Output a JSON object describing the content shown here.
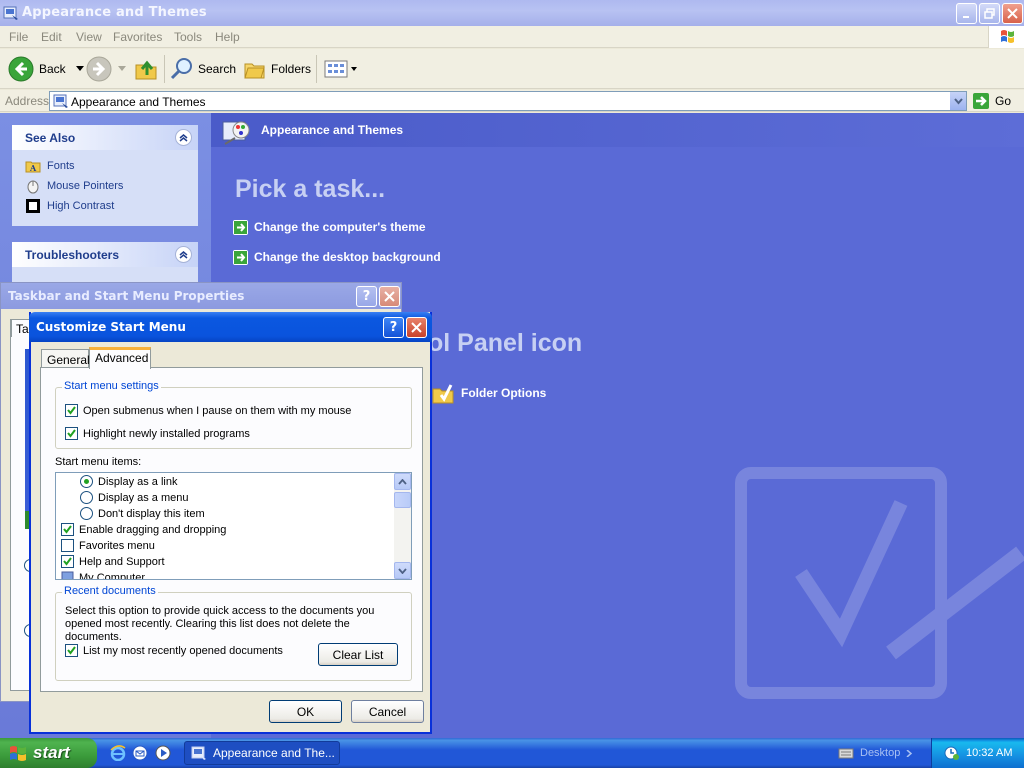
{
  "explorer": {
    "title": "Appearance and Themes",
    "menu": [
      "File",
      "Edit",
      "View",
      "Favorites",
      "Tools",
      "Help"
    ],
    "toolbar": {
      "back": "Back",
      "search": "Search",
      "folders": "Folders"
    },
    "address": {
      "label": "Address",
      "value": "Appearance and Themes",
      "go": "Go"
    },
    "see_also": {
      "title": "See Also",
      "items": [
        "Fonts",
        "Mouse Pointers",
        "High Contrast"
      ]
    },
    "troubleshooters": {
      "title": "Troubleshooters"
    },
    "content": {
      "header": "Appearance and Themes",
      "pick_task": "Pick a task...",
      "tasks": [
        "Change the computer's theme",
        "Change the desktop background"
      ],
      "or_pick": "ol Panel icon",
      "cp_icon": "Folder Options"
    }
  },
  "taskbar_props": {
    "title": "Taskbar and Start Menu Properties",
    "tab_partial": "Ta"
  },
  "customize": {
    "title": "Customize Start Menu",
    "tabs": [
      "General",
      "Advanced"
    ],
    "settings_group": "Start menu settings",
    "settings": [
      {
        "label": "Open submenus when I pause on them with my mouse",
        "checked": true
      },
      {
        "label": "Highlight newly installed programs",
        "checked": true
      }
    ],
    "items_label": "Start menu items:",
    "items": [
      {
        "type": "radio",
        "label": "Display as a link",
        "checked": true
      },
      {
        "type": "radio",
        "label": "Display as a menu",
        "checked": false
      },
      {
        "type": "radio",
        "label": "Don't display this item",
        "checked": false
      },
      {
        "type": "check",
        "label": "Enable dragging and dropping",
        "checked": true
      },
      {
        "type": "check",
        "label": "Favorites menu",
        "checked": false
      },
      {
        "type": "check",
        "label": "Help and Support",
        "checked": true
      },
      {
        "type": "icon",
        "label": "My Computer"
      }
    ],
    "recent_group": "Recent documents",
    "recent_desc": "Select this option to provide quick access to the documents you opened most recently.  Clearing this list does not delete the documents.",
    "recent_check": {
      "label": "List my most recently opened documents",
      "checked": true
    },
    "clear_list": "Clear List",
    "ok": "OK",
    "cancel": "Cancel"
  },
  "taskbar": {
    "start": "start",
    "active_task": "Appearance and The...",
    "desktop": "Desktop",
    "clock": "10:32 AM"
  },
  "colors": {
    "accent": "#0a53dd",
    "content_bg": "#5a6ad6",
    "link": "#1f3d8c",
    "group_legend": "#0046d5",
    "check_green": "#21a121"
  },
  "icons": [
    "control-panel-icon",
    "back-arrow-icon",
    "forward-arrow-icon",
    "up-folder-icon",
    "search-icon",
    "folders-icon",
    "views-icon",
    "go-arrow-icon",
    "fonts-folder-icon",
    "mouse-pointer-icon",
    "high-contrast-icon",
    "appearance-themes-icon",
    "task-arrow-icon",
    "folder-options-icon",
    "windows-flag-icon",
    "ie-icon",
    "media-icon",
    "keyboard-icon",
    "clock-icon"
  ]
}
